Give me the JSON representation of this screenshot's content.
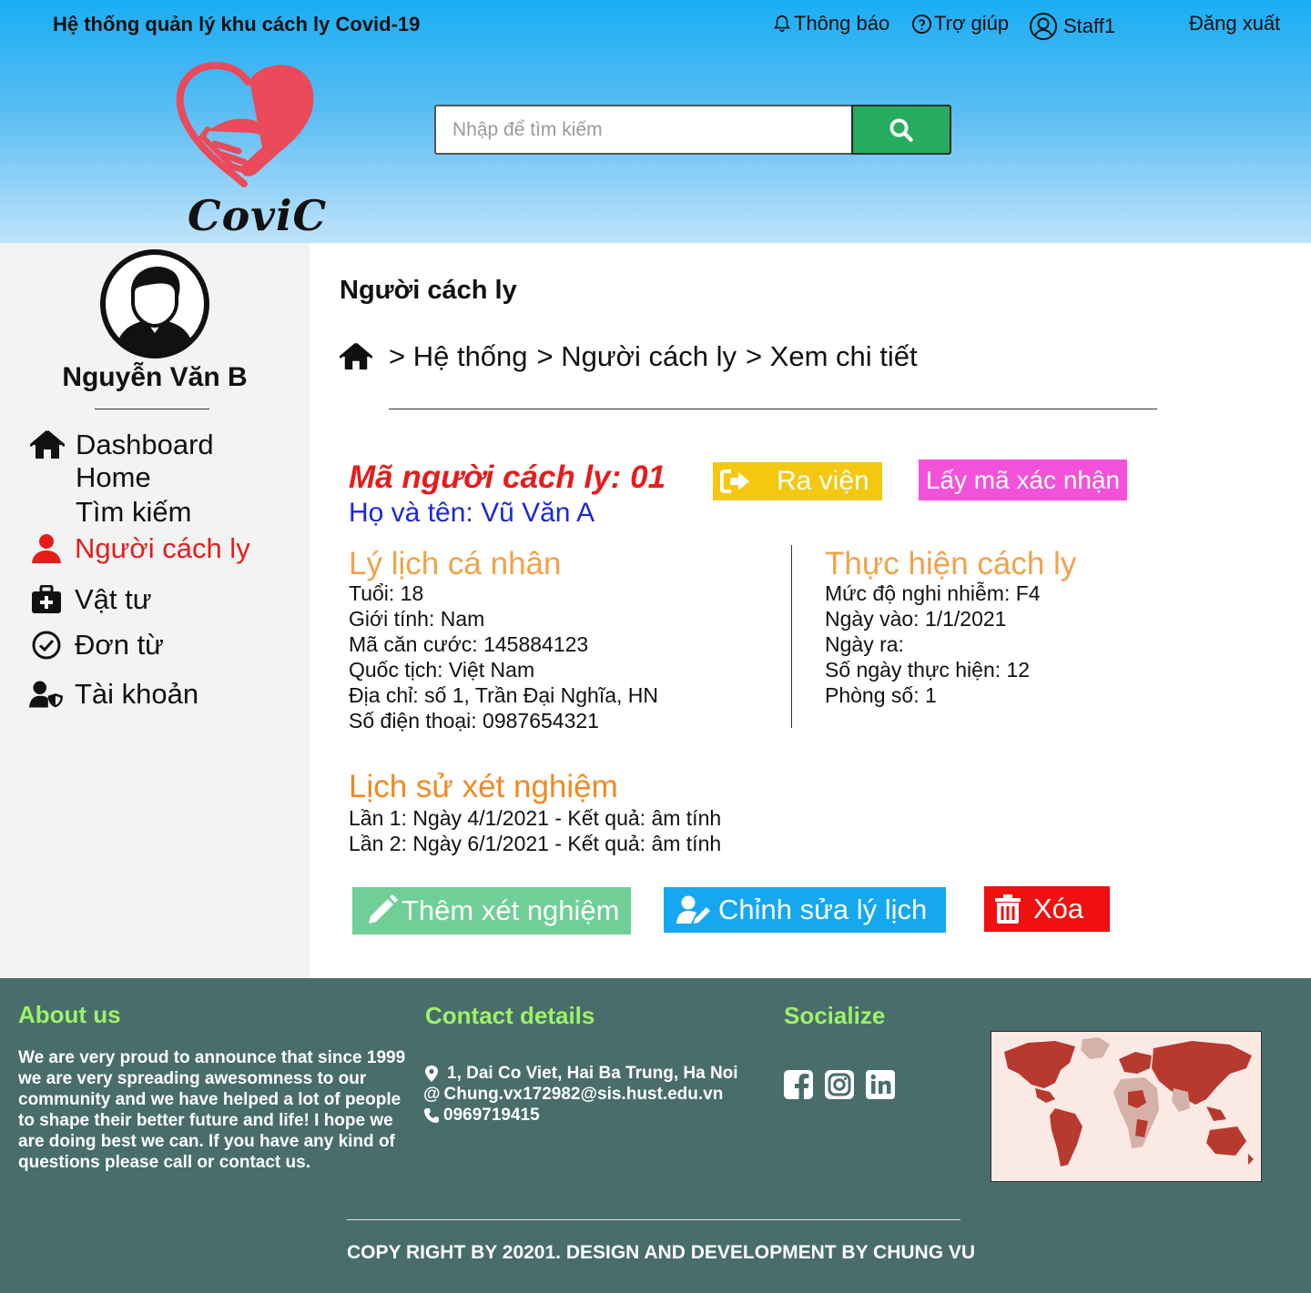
{
  "header": {
    "app_title": "Hệ thống quản lý khu cách  ly Covid-19",
    "notifications_label": "Thông báo",
    "help_label": "Trợ giúp",
    "user_label": "Staff1",
    "logout_label": "Đăng xuất",
    "logo_text": "CoviC",
    "search_placeholder": "Nhập để tìm kiếm"
  },
  "sidebar": {
    "user_name": "Nguyễn Văn B",
    "items": [
      {
        "label": "Dashboard",
        "icon": "home-icon"
      },
      {
        "label": "Home"
      },
      {
        "label": "Tìm kiếm"
      },
      {
        "label": "Người cách ly",
        "icon": "user-icon",
        "active": true
      },
      {
        "label": "Vật tư",
        "icon": "medkit-icon"
      },
      {
        "label": "Đơn từ",
        "icon": "check-circle-icon"
      },
      {
        "label": "Tài khoản",
        "icon": "user-shield-icon"
      }
    ]
  },
  "main": {
    "page_title": "Người cách ly",
    "breadcrumb": [
      "> Hệ thống",
      "> Người cách ly",
      "> Xem chi tiết"
    ],
    "patient": {
      "id_label": "Mã người cách ly: 01",
      "name_label": "Họ và tên:  Vũ Văn A"
    },
    "buttons": {
      "discharge": "Ra viện",
      "get_code": "Lấy mã xác nhận",
      "add_test": "Thêm xét nghiệm",
      "edit_profile": "Chỉnh sửa lý lịch",
      "delete": "Xóa"
    },
    "profile": {
      "title": "Lý lịch cá nhân",
      "lines": [
        "Tuổi: 18",
        "Giới tính: Nam",
        "Mã căn cước: 145884123",
        "Quốc tịch: Việt Nam",
        "Địa chỉ: số 1, Trần Đại Nghĩa, HN",
        "Số điện thoại: 0987654321"
      ]
    },
    "quarantine": {
      "title": "Thực hiện cách ly",
      "lines": [
        "Mức độ nghi nhiễm: F4",
        "Ngày vào: 1/1/2021",
        "Ngày ra:",
        "Số ngày thực hiện: 12",
        "Phòng số: 1"
      ]
    },
    "test_history": {
      "title": "Lịch sử xét nghiệm",
      "lines": [
        "Lần 1: Ngày 4/1/2021 - Kết quả: âm tính",
        "Lần 2: Ngày 6/1/2021 - Kết quả: âm tính"
      ]
    }
  },
  "footer": {
    "about_title": "About us",
    "about_text": "We are very proud to announce that since 1999 we are very spreading awesomness to our community and we have helped a lot of people to shape their better future and life! I hope we are doing best we can. If you have any kind of questions please call or contact us.",
    "contact_title": "Contact details",
    "address": "1, Dai Co Viet, Hai Ba Trung, Ha Noi",
    "email": "Chung.vx172982@sis.hust.edu.vn",
    "phone": "0969719415",
    "social_title": "Socialize",
    "social_icons": [
      "facebook-icon",
      "instagram-icon",
      "linkedin-icon"
    ],
    "copyright": "COPY RIGHT BY 20201. DESIGN AND DEVELOPMENT BY CHUNG VU"
  },
  "colors": {
    "header_blue": "#1aaef5",
    "search_green": "#26ad5f",
    "active_red": "#e61c1c",
    "name_blue": "#1b28d6",
    "section_orange": "#f0a24a",
    "discharge_yellow": "#f4c80f",
    "code_pink": "#f252d9",
    "add_green": "#6fcf97",
    "edit_blue": "#15a8f0",
    "delete_red": "#f01010",
    "footer_teal": "#486d6b",
    "footer_heading": "#9cf26b"
  }
}
